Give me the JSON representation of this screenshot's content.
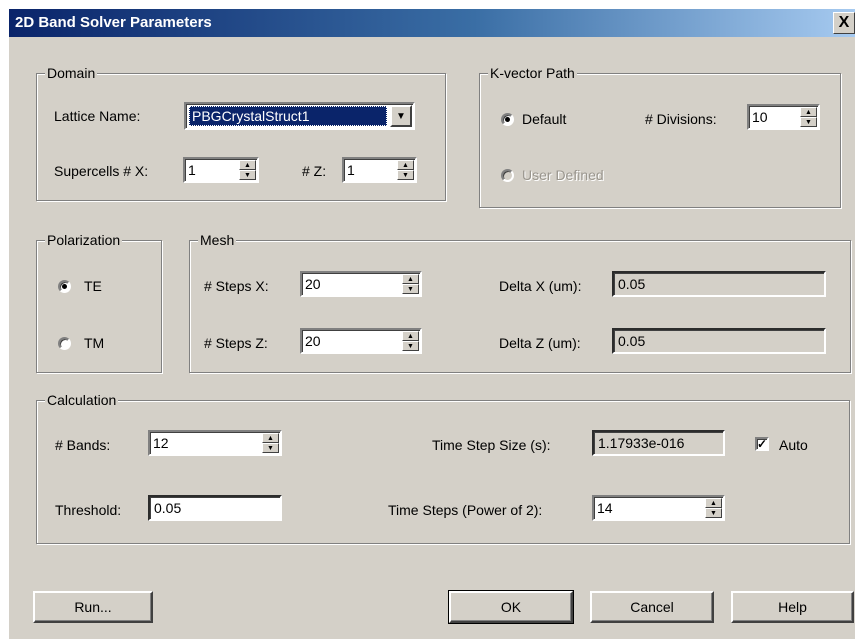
{
  "window": {
    "title": "2D Band Solver Parameters",
    "close_label": "X"
  },
  "domain": {
    "title": "Domain",
    "lattice_label": "Lattice Name:",
    "lattice_value": "PBGCrystalStruct1",
    "supercells_label": "Supercells # X:",
    "supercells_x": "1",
    "z_label": "# Z:",
    "supercells_z": "1"
  },
  "kvector": {
    "title": "K-vector Path",
    "default_label": "Default",
    "divisions_label": "# Divisions:",
    "divisions_value": "10",
    "user_defined_label": "User Defined",
    "selected": "Default"
  },
  "polarization": {
    "title": "Polarization",
    "te_label": "TE",
    "tm_label": "TM",
    "selected": "TE"
  },
  "mesh": {
    "title": "Mesh",
    "steps_x_label": "# Steps X:",
    "steps_x": "20",
    "steps_z_label": "# Steps Z:",
    "steps_z": "20",
    "delta_x_label": "Delta X (um):",
    "delta_x": "0.05",
    "delta_z_label": "Delta Z (um):",
    "delta_z": "0.05"
  },
  "calculation": {
    "title": "Calculation",
    "bands_label": "# Bands:",
    "bands_value": "12",
    "threshold_label": "Threshold:",
    "threshold_value": "0.05",
    "time_step_size_label": "Time Step Size (s):",
    "time_step_size_value": "1.17933e-016",
    "auto_label": "Auto",
    "auto_checked": true,
    "time_steps_label": "Time Steps (Power of 2):",
    "time_steps_value": "14"
  },
  "buttons": {
    "run": "Run...",
    "ok": "OK",
    "cancel": "Cancel",
    "help": "Help"
  },
  "icons": {
    "spin_up": "▲",
    "spin_down": "▼",
    "dropdown": "▼",
    "checkmark": "✓"
  }
}
